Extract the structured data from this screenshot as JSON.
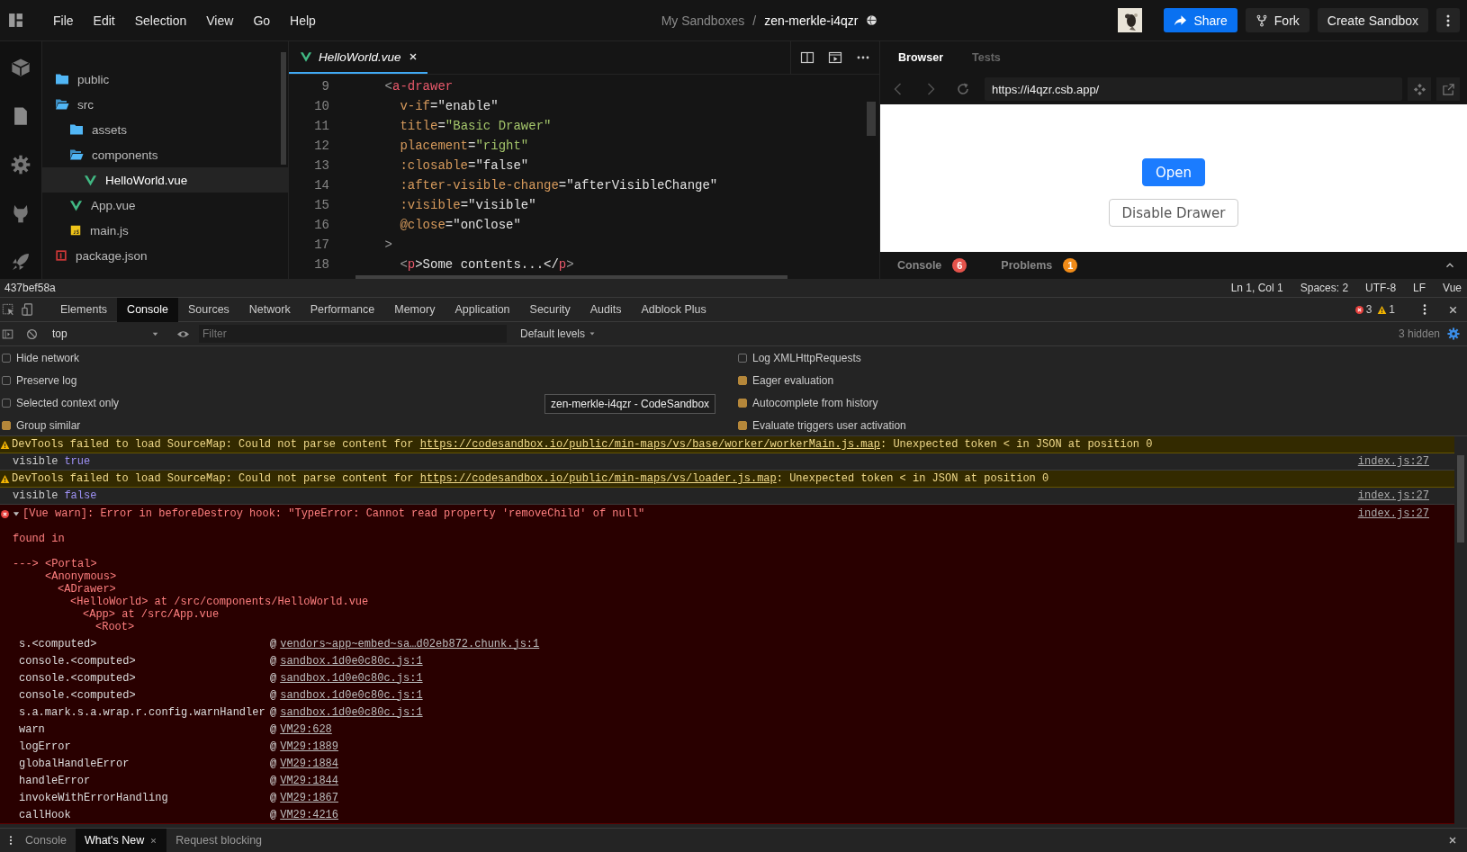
{
  "menu_bar": {
    "items": [
      "File",
      "Edit",
      "Selection",
      "View",
      "Go",
      "Help"
    ]
  },
  "breadcrumb": {
    "parent": "My Sandboxes",
    "separator": "/",
    "title": "zen-merkle-i4qzr"
  },
  "header_actions": {
    "share": "Share",
    "fork": "Fork",
    "create": "Create Sandbox"
  },
  "file_tree": [
    {
      "name": "public",
      "kind": "folder",
      "expanded": false,
      "selected": false
    },
    {
      "name": "src",
      "kind": "folder",
      "expanded": true,
      "selected": false,
      "children": [
        {
          "name": "assets",
          "kind": "folder",
          "expanded": false,
          "selected": false
        },
        {
          "name": "components",
          "kind": "folder",
          "expanded": true,
          "selected": false,
          "children": [
            {
              "name": "HelloWorld.vue",
              "kind": "vue",
              "selected": true
            }
          ]
        },
        {
          "name": "App.vue",
          "kind": "vue",
          "selected": false
        },
        {
          "name": "main.js",
          "kind": "js",
          "selected": false
        }
      ]
    },
    {
      "name": "package.json",
      "kind": "json",
      "selected": false
    }
  ],
  "editor": {
    "tabs": [
      {
        "label": "HelloWorld.vue",
        "selected": true
      }
    ],
    "lines": [
      {
        "number": "9",
        "tokens": [
          {
            "kind": "punct",
            "text": "    <"
          },
          {
            "kind": "tag",
            "text": "a-drawer"
          }
        ]
      },
      {
        "number": "10",
        "tokens": [
          {
            "kind": "attr",
            "text": "      v-if"
          },
          {
            "kind": "plain",
            "text": "=\"enable\""
          }
        ]
      },
      {
        "number": "11",
        "tokens": [
          {
            "kind": "attr",
            "text": "      title"
          },
          {
            "kind": "plain",
            "text": "="
          },
          {
            "kind": "string",
            "text": "\"Basic Drawer\""
          }
        ]
      },
      {
        "number": "12",
        "tokens": [
          {
            "kind": "attr",
            "text": "      placement"
          },
          {
            "kind": "plain",
            "text": "="
          },
          {
            "kind": "string",
            "text": "\"right\""
          }
        ]
      },
      {
        "number": "13",
        "tokens": [
          {
            "kind": "attr",
            "text": "      :closable"
          },
          {
            "kind": "plain",
            "text": "=\"false\""
          }
        ]
      },
      {
        "number": "14",
        "tokens": [
          {
            "kind": "attr",
            "text": "      :after-visible-change"
          },
          {
            "kind": "plain",
            "text": "=\"afterVisibleChange\""
          }
        ]
      },
      {
        "number": "15",
        "tokens": [
          {
            "kind": "attr",
            "text": "      :visible"
          },
          {
            "kind": "plain",
            "text": "=\"visible\""
          }
        ]
      },
      {
        "number": "16",
        "tokens": [
          {
            "kind": "attr",
            "text": "      @close"
          },
          {
            "kind": "plain",
            "text": "=\"onClose\""
          }
        ]
      },
      {
        "number": "17",
        "tokens": [
          {
            "kind": "punct",
            "text": "    >"
          }
        ]
      },
      {
        "number": "18",
        "tokens": [
          {
            "kind": "punct",
            "text": "      <"
          },
          {
            "kind": "tag",
            "text": "p"
          },
          {
            "kind": "plain",
            "text": ">Some contents...</"
          },
          {
            "kind": "tag",
            "text": "p"
          },
          {
            "kind": "punct",
            "text": ">"
          }
        ]
      }
    ]
  },
  "browser": {
    "tabs": [
      {
        "label": "Browser",
        "selected": true
      },
      {
        "label": "Tests",
        "selected": false
      }
    ],
    "url": "https://i4qzr.csb.app/",
    "buttons": [
      {
        "label": "Open",
        "kind": "primary"
      },
      {
        "label": "Disable Drawer",
        "kind": "default"
      }
    ],
    "panels": [
      {
        "label": "Console",
        "count": "6",
        "color": "#e5534b"
      },
      {
        "label": "Problems",
        "count": "1",
        "color": "#f28c18"
      }
    ]
  },
  "status_bar": {
    "commit": "437bef58a",
    "items": [
      "Ln 1, Col 1",
      "Spaces: 2",
      "UTF-8",
      "LF",
      "Vue"
    ]
  },
  "devtools": {
    "tabs": [
      {
        "label": "Elements",
        "selected": false
      },
      {
        "label": "Console",
        "selected": true
      },
      {
        "label": "Sources",
        "selected": false
      },
      {
        "label": "Network",
        "selected": false
      },
      {
        "label": "Performance",
        "selected": false
      },
      {
        "label": "Memory",
        "selected": false
      },
      {
        "label": "Application",
        "selected": false
      },
      {
        "label": "Security",
        "selected": false
      },
      {
        "label": "Audits",
        "selected": false
      },
      {
        "label": "Adblock Plus",
        "selected": false
      }
    ],
    "error_count": "3",
    "warning_count": "1",
    "context": "top",
    "filter_placeholder": "Filter",
    "levels": "Default levels",
    "hidden": "3 hidden",
    "settings": [
      {
        "label": "Hide network",
        "checked": false
      },
      {
        "label": "Preserve log",
        "checked": false
      },
      {
        "label": "Selected context only",
        "checked": false
      },
      {
        "label": "Group similar",
        "checked": true
      },
      {
        "label": "Log XMLHttpRequests",
        "checked": false
      },
      {
        "label": "Eager evaluation",
        "checked": true
      },
      {
        "label": "Autocomplete from history",
        "checked": true
      },
      {
        "label": "Evaluate triggers user activation",
        "checked": true
      }
    ],
    "tooltip": "zen-merkle-i4qzr - CodeSandbox",
    "messages": [
      {
        "kind": "warning",
        "text": "DevTools failed to load SourceMap: Could not parse content for ",
        "link": "https://codesandbox.io/public/min-maps/vs/base/worker/workerMain.js.map",
        "tail": ": Unexpected token < in JSON at position 0"
      },
      {
        "kind": "log",
        "text": "visible",
        "value": "true",
        "source": "index.js:27"
      },
      {
        "kind": "warning",
        "text": "DevTools failed to load SourceMap: Could not parse content for ",
        "link": "https://codesandbox.io/public/min-maps/vs/loader.js.map",
        "tail": ": Unexpected token < in JSON at position 0"
      },
      {
        "kind": "log",
        "text": "visible",
        "value": "false",
        "source": "index.js:27"
      },
      {
        "kind": "error",
        "expanded": true,
        "text": "[Vue warn]: Error in beforeDestroy hook: \"TypeError: Cannot read property 'removeChild' of null\"",
        "source": "index.js:27",
        "details": "found in",
        "tree": [
          {
            "text": "---> <Portal>",
            "children": [
              {
                "text": "<Anonymous>",
                "children": [
                  {
                    "text": "<ADrawer>",
                    "children": [
                      {
                        "text": "<HelloWorld> at /src/components/HelloWorld.vue",
                        "children": [
                          {
                            "text": "<App> at /src/App.vue",
                            "children": [
                              {
                                "text": "<Root>"
                              }
                            ]
                          }
                        ]
                      }
                    ]
                  }
                ]
              }
            ]
          }
        ],
        "stack": [
          {
            "function": "s.<computed>",
            "at": "@",
            "link": "vendors~app~embed~sa…d02eb872.chunk.js:1"
          },
          {
            "function": "console.<computed>",
            "at": "@",
            "link": "sandbox.1d0e0c80c.js:1"
          },
          {
            "function": "console.<computed>",
            "at": "@",
            "link": "sandbox.1d0e0c80c.js:1"
          },
          {
            "function": "console.<computed>",
            "at": "@",
            "link": "sandbox.1d0e0c80c.js:1"
          },
          {
            "function": "s.a.mark.s.a.wrap.r.config.warnHandler",
            "at": "@",
            "link": "sandbox.1d0e0c80c.js:1"
          },
          {
            "function": "warn",
            "at": "@",
            "link": "VM29:628"
          },
          {
            "function": "logError",
            "at": "@",
            "link": "VM29:1889"
          },
          {
            "function": "globalHandleError",
            "at": "@",
            "link": "VM29:1884"
          },
          {
            "function": "handleError",
            "at": "@",
            "link": "VM29:1844"
          },
          {
            "function": "invokeWithErrorHandling",
            "at": "@",
            "link": "VM29:1867"
          },
          {
            "function": "callHook",
            "at": "@",
            "link": "VM29:4216"
          }
        ]
      }
    ],
    "drawer_tabs": [
      {
        "label": "Console",
        "selected": false
      },
      {
        "label": "What's New",
        "selected": true
      },
      {
        "label": "Request blocking",
        "selected": false
      }
    ]
  }
}
